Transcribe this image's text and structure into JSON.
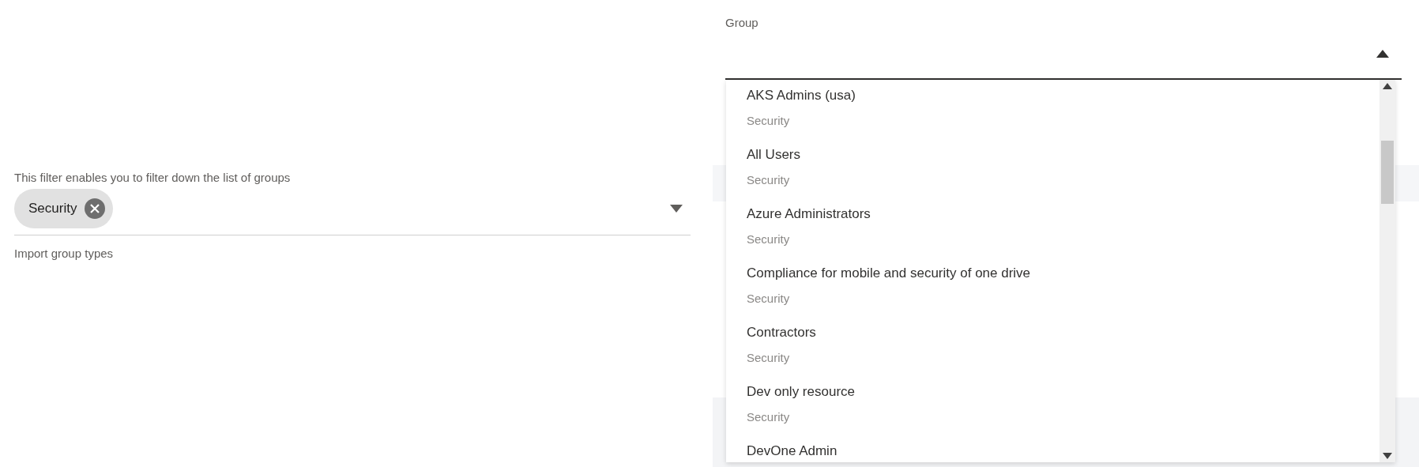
{
  "filter": {
    "hint": "This filter enables you to filter down the list of groups",
    "chips": [
      {
        "label": "Security"
      }
    ],
    "helper": "Import group types"
  },
  "group_field": {
    "label": "Group",
    "expanded": true
  },
  "options": [
    {
      "name": "AKS Admins (usa)",
      "type": "Security"
    },
    {
      "name": "All Users",
      "type": "Security"
    },
    {
      "name": "Azure Administrators",
      "type": "Security"
    },
    {
      "name": "Compliance for mobile and security of one drive",
      "type": "Security"
    },
    {
      "name": "Contractors",
      "type": "Security"
    },
    {
      "name": "Dev only resource",
      "type": "Security"
    },
    {
      "name": "DevOne Admin"
    }
  ]
}
